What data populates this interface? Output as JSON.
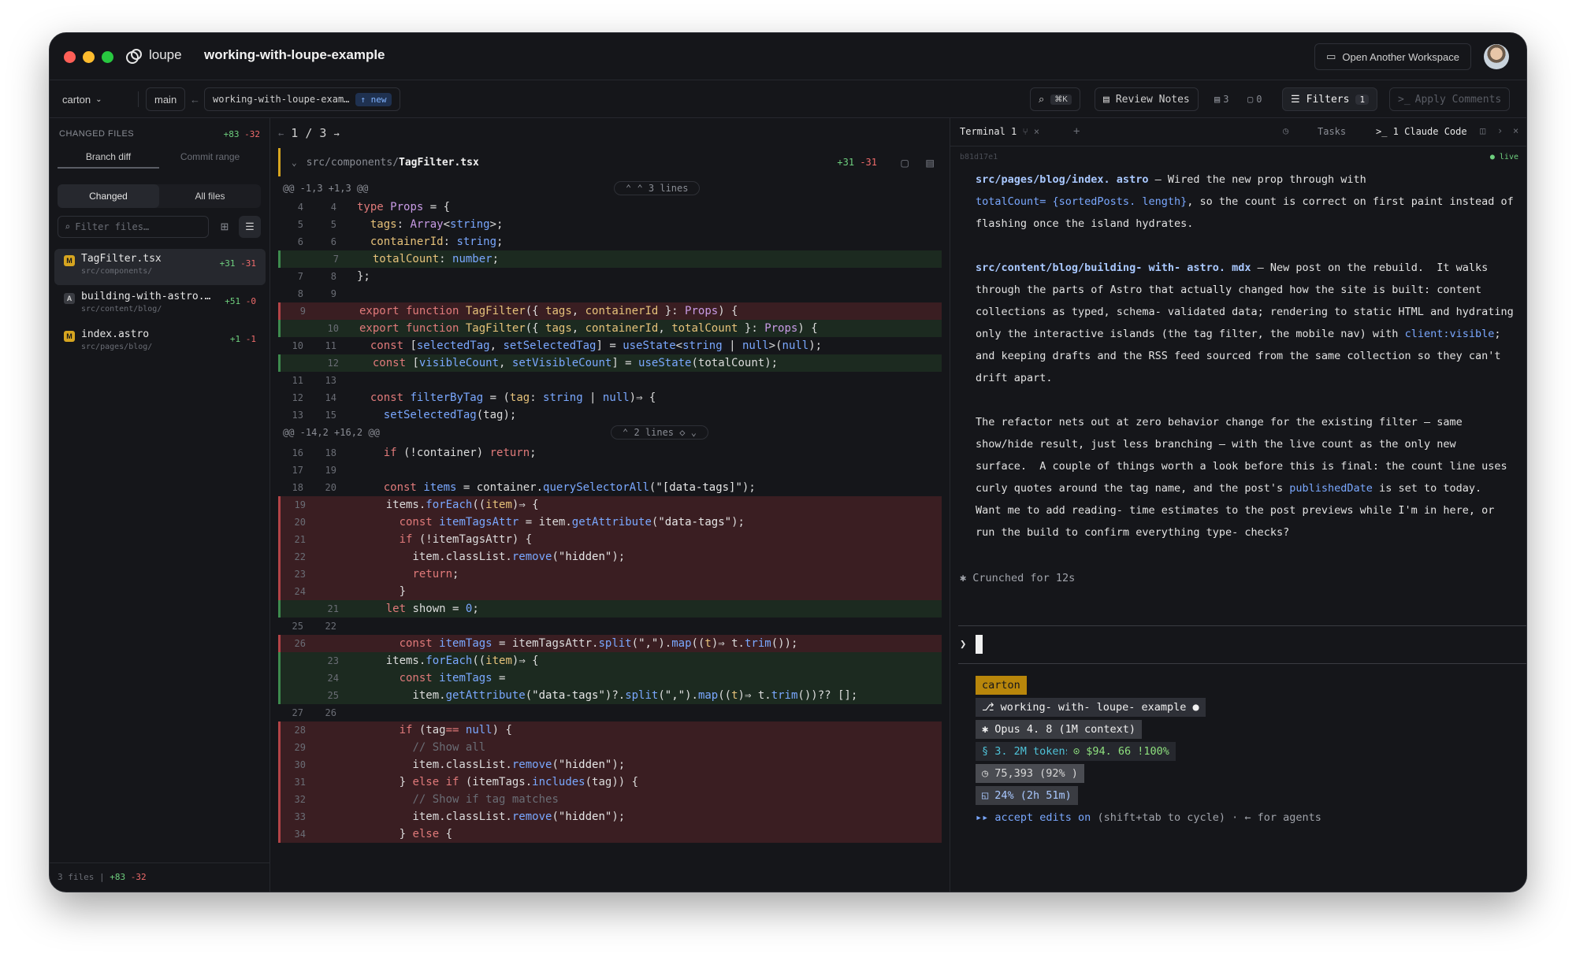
{
  "window": {
    "app_name": "loupe",
    "workspace_name": "working-with-loupe-example",
    "open_workspace_label": "Open Another Workspace"
  },
  "toolbar": {
    "repo": "carton",
    "branch": "main",
    "arrow": "←",
    "target_branch": "working-with-loupe-exam…",
    "new_badge": "↑ new",
    "shortcut": "⌘K",
    "review_notes": "Review Notes",
    "notes_count": "3",
    "comments_count": "0",
    "filters_label": "Filters",
    "filters_count": "1",
    "apply_comments": "Apply Comments"
  },
  "sidebar": {
    "header": "CHANGED FILES",
    "total_add": "+83",
    "total_del": "-32",
    "tabs": [
      "Branch diff",
      "Commit range"
    ],
    "segments": [
      "Changed",
      "All files"
    ],
    "filter_placeholder": "Filter files…",
    "files": [
      {
        "badge": "M",
        "name": "TagFilter.tsx",
        "path": "src/components/",
        "add": "+31",
        "del": "-31"
      },
      {
        "badge": "A",
        "name": "building-with-astro.…",
        "path": "src/content/blog/",
        "add": "+51",
        "del": "-0"
      },
      {
        "badge": "M",
        "name": "index.astro",
        "path": "src/pages/blog/",
        "add": "+1",
        "del": "-1"
      }
    ],
    "footer_files": "3 files",
    "footer_add": "+83",
    "footer_del": "-32"
  },
  "diff": {
    "pager": "1 / 3",
    "file_dir": "src/components/",
    "file_name": "TagFilter.tsx",
    "file_add": "+31",
    "file_del": "-31",
    "expand1": "⌃ ⌃ 3 lines",
    "expand2": "⌃ 2 lines ◇ ⌄"
  },
  "terminal": {
    "tab": "Terminal 1",
    "tasks": "Tasks",
    "claude": ">_ 1 Claude Code",
    "commit": "b81d17e1",
    "live": "● live",
    "crunched": "✱ Crunched for 12s",
    "prompt": "❯",
    "status": {
      "repo": "carton",
      "branch": "⎇ working- with- loupe- example ●",
      "model": "✱ Opus 4. 8 (1M context)",
      "tokens": "§ 3. 2M tokens",
      "cost": "⊙ $94. 66 !100%",
      "ctx": "◷ 75,393 (92% )",
      "usage": "◱ 24% (2h 51m)",
      "mode_prefix": "▸▸ ",
      "mode": "accept edits on",
      "mode_suffix": " (shift+tab to cycle) · ← for agents"
    }
  },
  "colors": {
    "modified": "#d6a520",
    "added_badge": "#8a8d95",
    "add": "#6ecf7e",
    "del": "#ef6b6b",
    "accent": "#7aa8ff"
  }
}
